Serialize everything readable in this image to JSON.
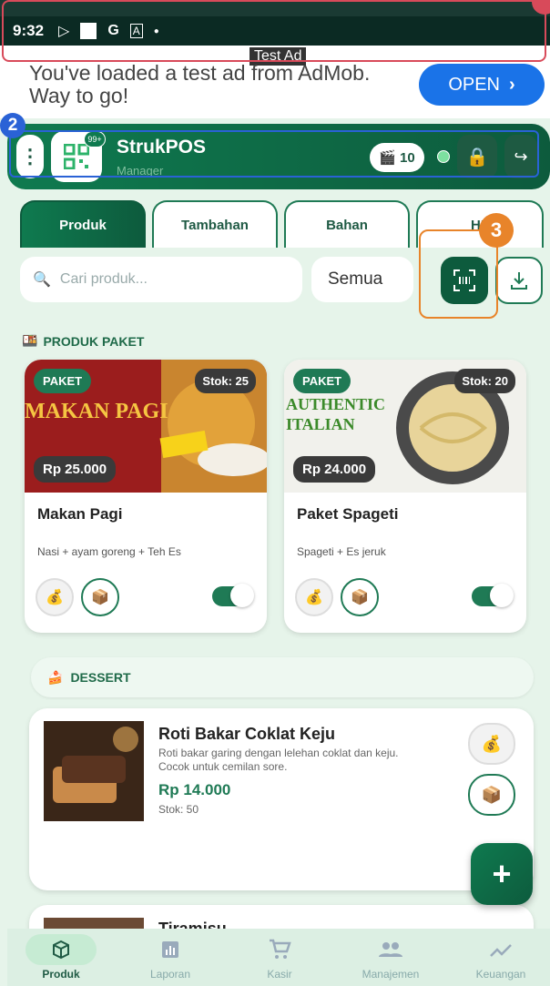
{
  "status_bar": {
    "time": "9:32",
    "icons": [
      "play-store-icon",
      "notification-icon",
      "google-icon",
      "accessibility-icon",
      "dot-icon"
    ]
  },
  "ad": {
    "label": "Test Ad",
    "text": "You've loaded a test ad from AdMob. Way to go!",
    "button": "OPEN",
    "button_color": "#1a73e8"
  },
  "annotations": {
    "badge_2": "2",
    "badge_3": "3"
  },
  "header": {
    "title": "StrukPOS",
    "subtitle": "Manager",
    "logo_badge": "99+",
    "counter": "10"
  },
  "tabs": [
    {
      "label": "Produk",
      "active": true
    },
    {
      "label": "Tambahan",
      "active": false
    },
    {
      "label": "Bahan",
      "active": false
    },
    {
      "label": "HF",
      "active": false
    }
  ],
  "toolbar": {
    "search_placeholder": "Cari produk...",
    "filter_value": "Semua"
  },
  "section_paket": {
    "label": "PRODUK PAKET"
  },
  "products": [
    {
      "badge": "PAKET",
      "stock": "Stok: 25",
      "price": "Rp 25.000",
      "name": "Makan Pagi",
      "desc": "Nasi + ayam goreng + Teh Es",
      "image_text": "MAKAN PAGI",
      "active": true
    },
    {
      "badge": "PAKET",
      "stock": "Stok: 20",
      "price": "Rp 24.000",
      "name": "Paket Spageti",
      "desc": "Spageti + Es jeruk",
      "image_text": "AUTHENTIC ITALIAN",
      "active": true
    }
  ],
  "section_dessert": {
    "label": "DESSERT"
  },
  "items": [
    {
      "name": "Roti Bakar Coklat Keju",
      "desc": "Roti bakar garing dengan lelehan coklat dan keju. Cocok untuk cemilan sore.",
      "price": "Rp 14.000",
      "stock": "Stok: 50"
    },
    {
      "name": "Tiramisu"
    }
  ],
  "fab": {
    "label": "+"
  },
  "bottom_nav": [
    {
      "label": "Produk",
      "icon": "box-icon",
      "active": true
    },
    {
      "label": "Laporan",
      "icon": "chart-icon",
      "active": false
    },
    {
      "label": "Kasir",
      "icon": "cart-icon",
      "active": false
    },
    {
      "label": "Manajemen",
      "icon": "people-icon",
      "active": false
    },
    {
      "label": "Keuangan",
      "icon": "trend-icon",
      "active": false
    }
  ],
  "colors": {
    "primary": "#0f7a4f",
    "primary_dark": "#0d5b3d",
    "background": "#e6f4ea"
  }
}
